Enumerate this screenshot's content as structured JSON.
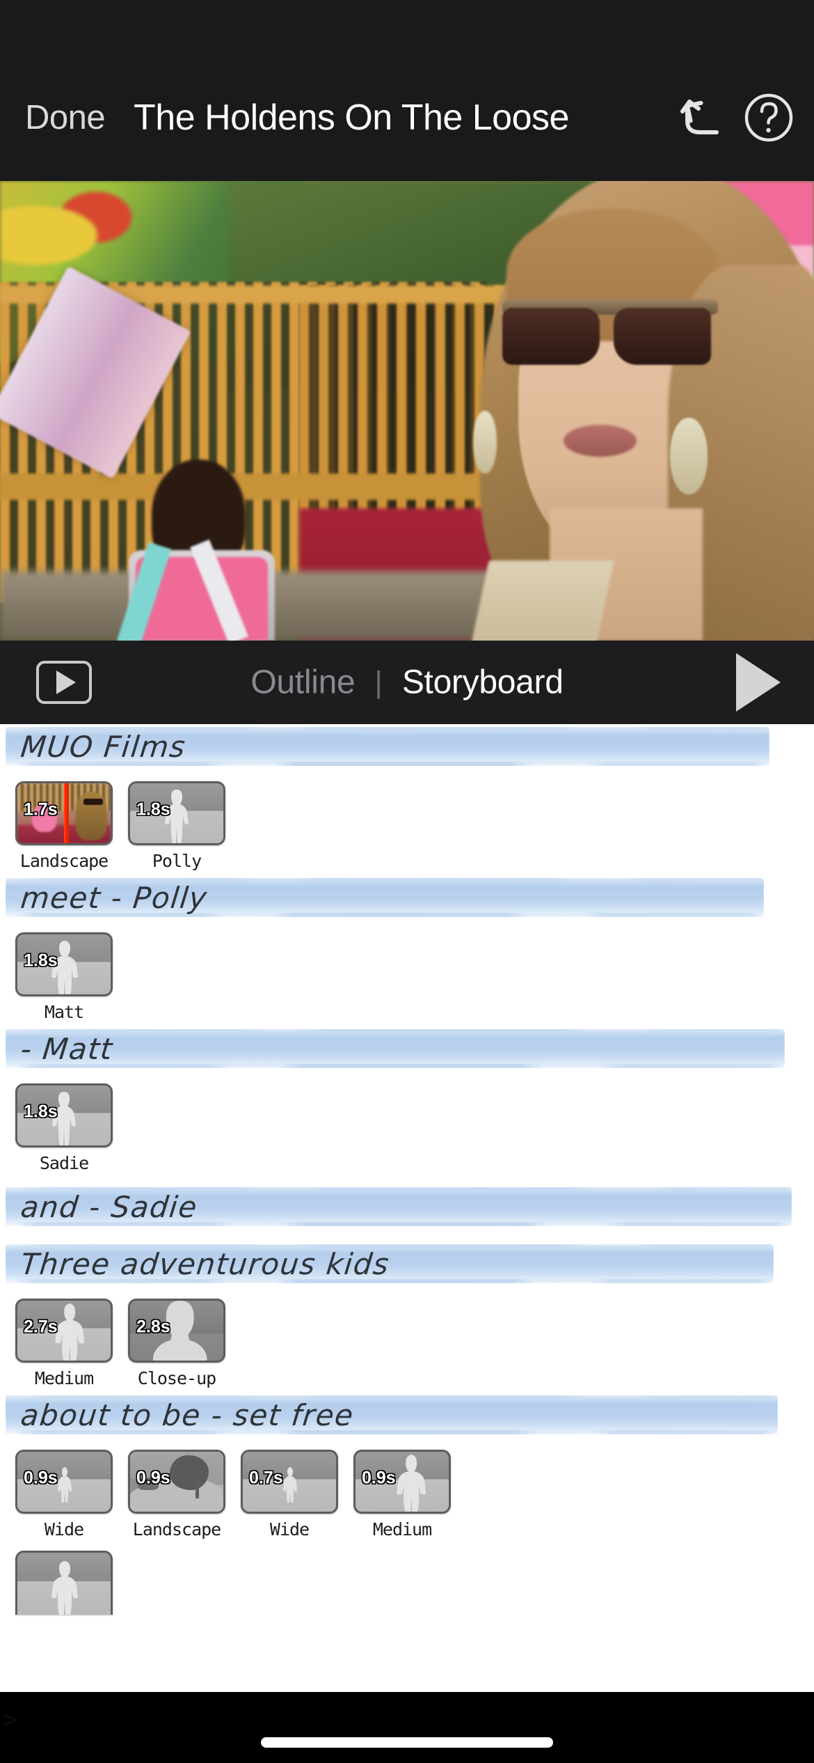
{
  "nav": {
    "done_label": "Done",
    "title": "The Holdens On The Loose",
    "undo_icon": "undo-arrow-icon",
    "help_icon": "question-mark-circle-icon"
  },
  "preview": {
    "description": "Video preview frame of woman in sunglasses at a fairground"
  },
  "transport": {
    "play_box_icon": "play-in-rect-icon",
    "outline_tab": "Outline",
    "separator": "|",
    "storyboard_tab": "Storyboard",
    "play_icon": "play-triangle-icon",
    "active_tab": "Storyboard"
  },
  "storyboard": {
    "more_indicator": ">",
    "sections": [
      {
        "title": "MUO Films",
        "shots": [
          {
            "duration": "1.7s",
            "caption": "Landscape",
            "kind": "video-frame"
          },
          {
            "duration": "1.8s",
            "caption": "Polly",
            "kind": "woman"
          }
        ]
      },
      {
        "title": "meet - Polly",
        "shots": [
          {
            "duration": "1.8s",
            "caption": "Matt",
            "kind": "man"
          }
        ]
      },
      {
        "title": "- Matt",
        "shots": [
          {
            "duration": "1.8s",
            "caption": "Sadie",
            "kind": "woman"
          }
        ]
      },
      {
        "title": "and - Sadie",
        "shots": []
      },
      {
        "title": "Three adventurous kids",
        "shots": [
          {
            "duration": "2.7s",
            "caption": "Medium",
            "kind": "man-medium"
          },
          {
            "duration": "2.8s",
            "caption": "Close-up",
            "kind": "closeup"
          }
        ]
      },
      {
        "title": "about to be - set free",
        "shots": [
          {
            "duration": "0.9s",
            "caption": "Wide",
            "kind": "wide"
          },
          {
            "duration": "0.9s",
            "caption": "Landscape",
            "kind": "landscape"
          },
          {
            "duration": "0.7s",
            "caption": "Wide",
            "kind": "wide"
          },
          {
            "duration": "0.9s",
            "caption": "Medium",
            "kind": "man-medium"
          }
        ]
      }
    ]
  },
  "colors": {
    "nav_background": "#1a1a1c",
    "board_background": "#ffffff",
    "banner_blue": "#bad2ee",
    "banner_text": "#2f3338",
    "thumb_border": "#5d5d5d",
    "playhead_red": "#ff2b08",
    "active_tab_text": "#ffffff",
    "inactive_tab_text": "#8a8a8e"
  }
}
